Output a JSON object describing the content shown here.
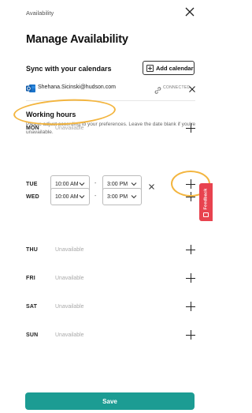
{
  "header": {
    "breadcrumb": "Availability",
    "title": "Manage Availability"
  },
  "calendar_sync": {
    "title": "Sync with your calendars",
    "add_button_label": "Add calendar",
    "account": {
      "email": "Shehana.Sicinski@hudson.com",
      "status": "CONNECTED",
      "provider_icon": "outlook-icon"
    }
  },
  "working_hours": {
    "title": "Working hours",
    "description": "Please adjust according to your preferences. Leave the date blank if you're unavailable.",
    "unavailable_text": "Unavailable",
    "time_separator": "-",
    "days": [
      {
        "label": "MON",
        "unavailable": true
      },
      {
        "label": "TUE",
        "unavailable": false,
        "start": "10:00 AM",
        "end": "3:00 PM"
      },
      {
        "label": "WED",
        "unavailable": false,
        "start": "10:00 AM",
        "end": "3:00 PM"
      },
      {
        "label": "THU",
        "unavailable": true
      },
      {
        "label": "FRI",
        "unavailable": true
      },
      {
        "label": "SAT",
        "unavailable": true
      },
      {
        "label": "SUN",
        "unavailable": true
      }
    ]
  },
  "feedback": {
    "label": "Feedback"
  },
  "footer": {
    "save_label": "Save"
  },
  "colors": {
    "primary": "#1c9c93",
    "feedback": "#e8434f",
    "annotation": "#f3b53f"
  }
}
